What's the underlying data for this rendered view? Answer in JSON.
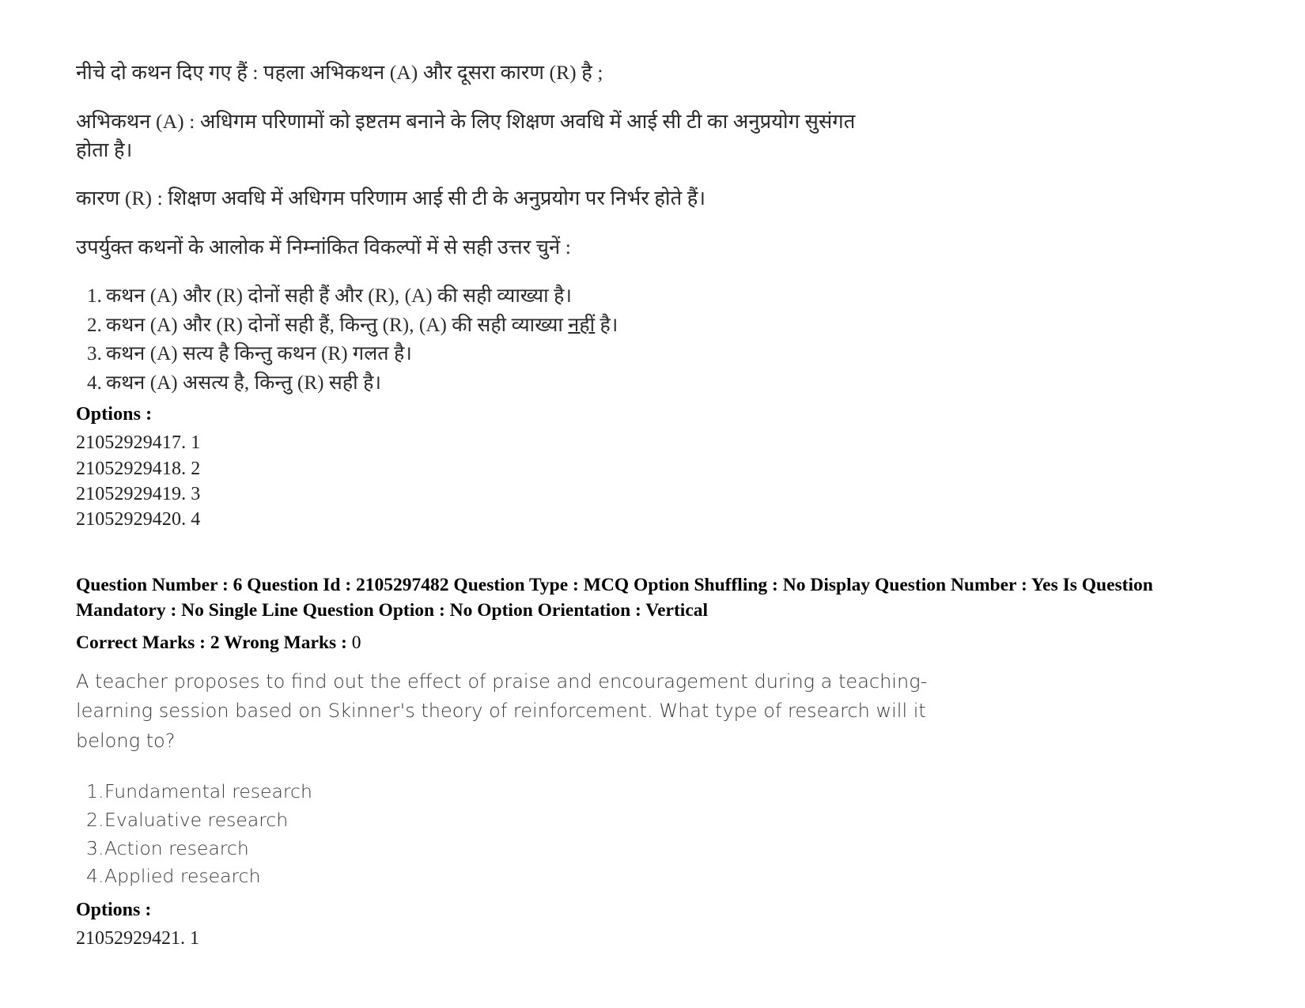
{
  "document": {
    "language_blocks": [
      "hindi",
      "english"
    ]
  },
  "hindi_question": {
    "intro": "नीचे दो कथन दिए गए हैं : पहला अभिकथन (A) और दूसरा कारण (R) है ;",
    "assertion_line1": "अभिकथन (A) : अधिगम परिणामों को इष्टतम बनाने के लिए शिक्षण अवधि में आई सी टी का अनुप्रयोग सुसंगत",
    "assertion_line2": "होता है।",
    "reason": "कारण (R) : शिक्षण अवधि में अधिगम परिणाम आई सी टी के अनुप्रयोग पर निर्भर होते हैं।",
    "instruction": "उपर्युक्त कथनों के आलोक में निम्नांकित विकल्पों में से सही उत्तर चुनें :",
    "choices": [
      {
        "number": "1.",
        "text_before": "कथन (A) और (R) दोनों सही हैं और (R), (A) की सही व्याख्या है।",
        "underlined": "",
        "text_after": ""
      },
      {
        "number": "2.",
        "text_before": "कथन (A) और (R) दोनों सही हैं, किन्तु (R), (A) की सही व्याख्या ",
        "underlined": "नहीं",
        "text_after": " है।"
      },
      {
        "number": "3.",
        "text_before": "कथन (A) सत्य है किन्तु कथन (R) गलत है।",
        "underlined": "",
        "text_after": ""
      },
      {
        "number": "4.",
        "text_before": "कथन (A) असत्य है, किन्तु (R) सही है।",
        "underlined": "",
        "text_after": ""
      }
    ],
    "options_label": "Options :",
    "option_ids": [
      "21052929417. 1",
      "21052929418. 2",
      "21052929419. 3",
      "21052929420. 4"
    ]
  },
  "english_question": {
    "metadata_line1": "Question Number : 6 Question Id : 2105297482 Question Type : MCQ Option Shuffling : No Display Question Number : Yes Is Question",
    "metadata_line2": "Mandatory : No Single Line Question Option : No Option Orientation : Vertical",
    "marks_label": "Correct Marks : 2 Wrong Marks : ",
    "marks_wrong_value": "0",
    "body_lines": [
      "A teacher proposes to find out the effect of praise and encouragement during a teaching-",
      "learning session based on Skinner's theory of reinforcement. What type of research will it",
      "belong to?"
    ],
    "choices": [
      {
        "number": "1.",
        "text": "Fundamental research"
      },
      {
        "number": "2.",
        "text": "Evaluative research"
      },
      {
        "number": "3.",
        "text": "Action research"
      },
      {
        "number": "4.",
        "text": "Applied research"
      }
    ],
    "options_label": "Options :",
    "option_ids": [
      "21052929421. 1"
    ]
  },
  "colors": {
    "page_background": "#ffffff",
    "body_text": "#2a2a2a",
    "english_text": "#3a3a3a",
    "metadata_text": "#000000"
  }
}
